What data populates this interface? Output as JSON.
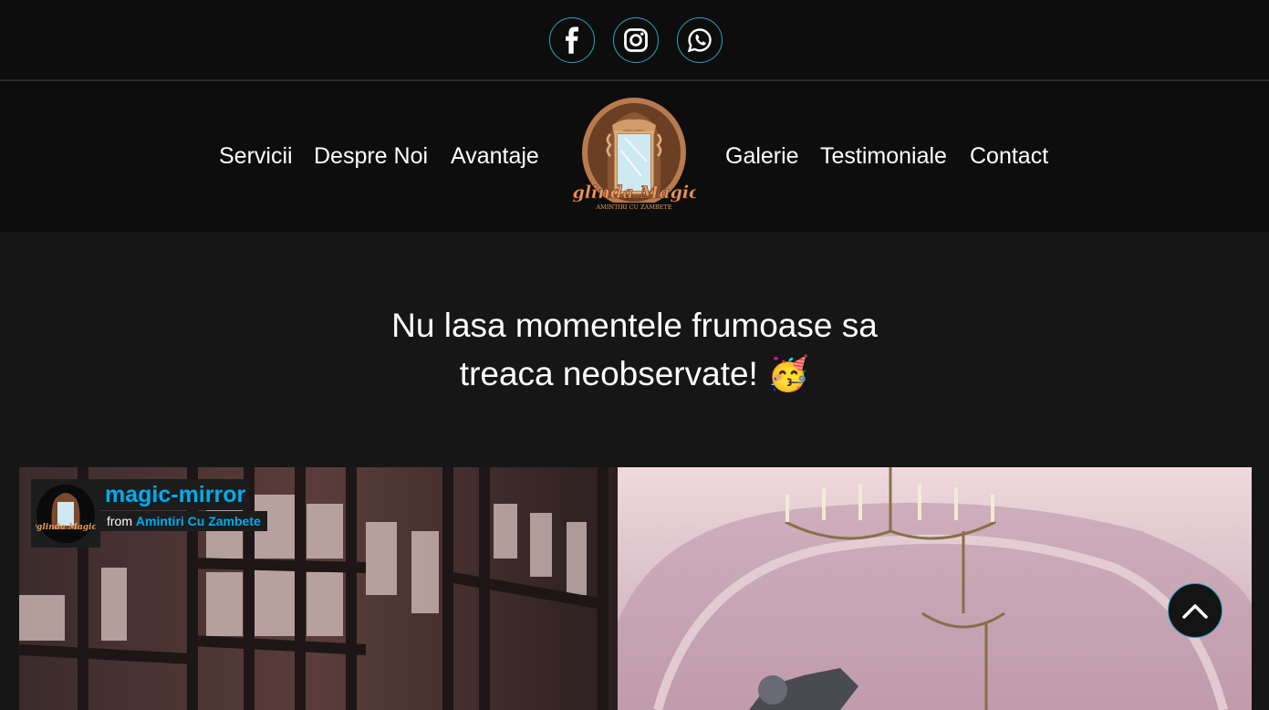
{
  "social": {
    "icons": [
      "facebook-icon",
      "instagram-icon",
      "whatsapp-icon"
    ],
    "accent": "#2aa3c4"
  },
  "nav": {
    "left": [
      "Servicii",
      "Despre Noi",
      "Avantaje"
    ],
    "right": [
      "Galerie",
      "Testimoniale",
      "Contact"
    ]
  },
  "logo": {
    "brand": "Oglinda Magică",
    "tagline": "AMINTIRI CU ZAMBETE"
  },
  "hero": {
    "line1": "Nu lasa momentele frumoase sa",
    "line2": "treaca neobservate! 🥳"
  },
  "video": {
    "title": "magic-mirror",
    "from_label": "from",
    "channel": "Amintiri Cu Zambete",
    "link_color": "#00adef"
  },
  "scroll_top": {
    "icon": "chevron-up-icon"
  }
}
